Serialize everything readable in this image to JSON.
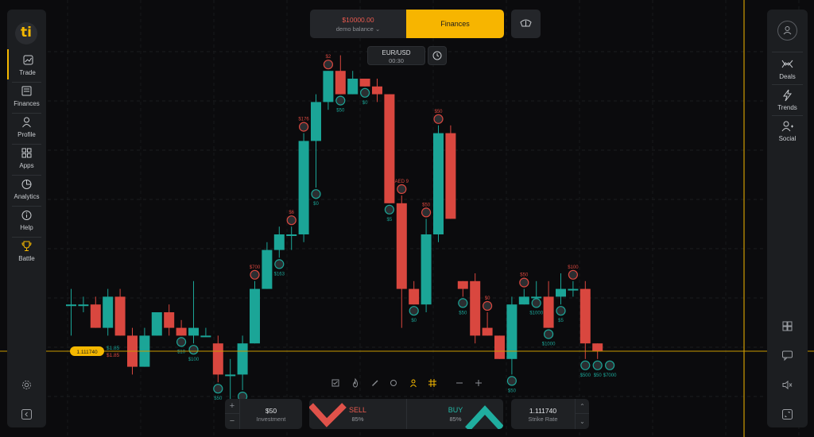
{
  "app": {
    "logo_text": "ti"
  },
  "sidebar_left": {
    "items": [
      {
        "label": "Trade",
        "icon": "chart-icon"
      },
      {
        "label": "Finances",
        "icon": "wallet-icon"
      },
      {
        "label": "Profile",
        "icon": "user-icon"
      },
      {
        "label": "Apps",
        "icon": "apps-icon"
      },
      {
        "label": "Analytics",
        "icon": "pie-icon"
      },
      {
        "label": "Help",
        "icon": "info-icon"
      },
      {
        "label": "Battle",
        "icon": "trophy-icon"
      }
    ],
    "bottom_icons": [
      "settings-icon",
      "collapse-icon"
    ]
  },
  "sidebar_right": {
    "items": [
      {
        "label": "Deals",
        "icon": "deals-icon"
      },
      {
        "label": "Trends",
        "icon": "trends-icon"
      },
      {
        "label": "Social",
        "icon": "add-user-icon"
      }
    ],
    "bottom_icons": [
      "layout-icon",
      "chat-icon",
      "sound-off-icon",
      "fullscreen-icon"
    ]
  },
  "header": {
    "balance": "$10000.00",
    "balance_type": "demo balance",
    "finances_label": "Finances"
  },
  "asset": {
    "name": "EUR/USD",
    "timer": "00:30"
  },
  "trade_panel": {
    "investment_value": "$50",
    "investment_label": "Investment",
    "plus": "+",
    "minus": "−",
    "sell_label": "SELL",
    "sell_pct": "85%",
    "buy_label": "BUY",
    "buy_pct": "85%",
    "strike_value": "1.111740",
    "strike_label": "Strike Rate"
  },
  "colors": {
    "up": "#1ba597",
    "down": "#d9473f",
    "accent": "#f5b800",
    "background": "#0b0b0d"
  },
  "chart_data": {
    "type": "candlestick",
    "current_price": "1.111740",
    "current_price_labels": [
      "$1.85",
      "$1.85"
    ],
    "candles": [
      {
        "t": 0,
        "o": 1.1118,
        "h": 1.11182,
        "l": 1.11176,
        "c": 1.1118
      },
      {
        "t": 1,
        "o": 1.1118,
        "h": 1.11181,
        "l": 1.11179,
        "c": 1.1118
      },
      {
        "t": 2,
        "o": 1.1118,
        "h": 1.11181,
        "l": 1.11177,
        "c": 1.11177
      },
      {
        "t": 3,
        "o": 1.11177,
        "h": 1.11182,
        "l": 1.11176,
        "c": 1.11181
      },
      {
        "t": 4,
        "o": 1.11181,
        "h": 1.11182,
        "l": 1.11176,
        "c": 1.11176
      },
      {
        "t": 5,
        "o": 1.11176,
        "h": 1.11177,
        "l": 1.11171,
        "c": 1.11172
      },
      {
        "t": 6,
        "o": 1.11172,
        "h": 1.11177,
        "l": 1.11172,
        "c": 1.11176
      },
      {
        "t": 7,
        "o": 1.11176,
        "h": 1.11179,
        "l": 1.11176,
        "c": 1.11179
      },
      {
        "t": 8,
        "o": 1.11179,
        "h": 1.1118,
        "l": 1.11176,
        "c": 1.11177
      },
      {
        "t": 9,
        "o": 1.11177,
        "h": 1.11178,
        "l": 1.11176,
        "c": 1.11176
      },
      {
        "t": 10,
        "o": 1.11176,
        "h": 1.11183,
        "l": 1.11175,
        "c": 1.11177
      },
      {
        "t": 11,
        "o": 1.11176,
        "h": 1.11177,
        "l": 1.11176,
        "c": 1.11176
      },
      {
        "t": 12,
        "o": 1.11175,
        "h": 1.11176,
        "l": 1.1117,
        "c": 1.11171
      },
      {
        "t": 13,
        "o": 1.11171,
        "h": 1.11173,
        "l": 1.11166,
        "c": 1.11171
      },
      {
        "t": 14,
        "o": 1.11171,
        "h": 1.11176,
        "l": 1.11169,
        "c": 1.11175
      },
      {
        "t": 15,
        "o": 1.11175,
        "h": 1.11183,
        "l": 1.11175,
        "c": 1.11182
      },
      {
        "t": 16,
        "o": 1.11182,
        "h": 1.11188,
        "l": 1.11182,
        "c": 1.11187
      },
      {
        "t": 17,
        "o": 1.11187,
        "h": 1.1119,
        "l": 1.11186,
        "c": 1.11189
      },
      {
        "t": 18,
        "o": 1.11189,
        "h": 1.1119,
        "l": 1.11187,
        "c": 1.11189
      },
      {
        "t": 19,
        "o": 1.11189,
        "h": 1.11202,
        "l": 1.11188,
        "c": 1.11201
      },
      {
        "t": 20,
        "o": 1.11201,
        "h": 1.11207,
        "l": 1.11195,
        "c": 1.11206
      },
      {
        "t": 21,
        "o": 1.11206,
        "h": 1.1121,
        "l": 1.11205,
        "c": 1.1121
      },
      {
        "t": 22,
        "o": 1.1121,
        "h": 1.11212,
        "l": 1.11207,
        "c": 1.11207
      },
      {
        "t": 23,
        "o": 1.11207,
        "h": 1.1121,
        "l": 1.11207,
        "c": 1.11209
      },
      {
        "t": 24,
        "o": 1.11209,
        "h": 1.11209,
        "l": 1.11208,
        "c": 1.11208
      },
      {
        "t": 25,
        "o": 1.11208,
        "h": 1.11209,
        "l": 1.11206,
        "c": 1.11207
      },
      {
        "t": 26,
        "o": 1.11207,
        "h": 1.11207,
        "l": 1.11193,
        "c": 1.11193
      },
      {
        "t": 27,
        "o": 1.11193,
        "h": 1.11194,
        "l": 1.11177,
        "c": 1.11182
      },
      {
        "t": 28,
        "o": 1.11182,
        "h": 1.11183,
        "l": 1.1118,
        "c": 1.1118
      },
      {
        "t": 29,
        "o": 1.1118,
        "h": 1.11191,
        "l": 1.11179,
        "c": 1.11189
      },
      {
        "t": 30,
        "o": 1.11189,
        "h": 1.11203,
        "l": 1.11188,
        "c": 1.11202
      },
      {
        "t": 31,
        "o": 1.11202,
        "h": 1.11203,
        "l": 1.11191,
        "c": 1.11191
      },
      {
        "t": 32,
        "o": 1.11183,
        "h": 1.11183,
        "l": 1.11181,
        "c": 1.11182
      },
      {
        "t": 33,
        "o": 1.11183,
        "h": 1.11184,
        "l": 1.11175,
        "c": 1.11176
      },
      {
        "t": 34,
        "o": 1.11177,
        "h": 1.11179,
        "l": 1.11176,
        "c": 1.11176
      },
      {
        "t": 35,
        "o": 1.11176,
        "h": 1.11176,
        "l": 1.11173,
        "c": 1.11173
      },
      {
        "t": 36,
        "o": 1.11173,
        "h": 1.11181,
        "l": 1.11171,
        "c": 1.1118
      },
      {
        "t": 37,
        "o": 1.1118,
        "h": 1.11182,
        "l": 1.1118,
        "c": 1.11181
      },
      {
        "t": 38,
        "o": 1.11181,
        "h": 1.11183,
        "l": 1.11181,
        "c": 1.11181
      },
      {
        "t": 39,
        "o": 1.11181,
        "h": 1.11183,
        "l": 1.11177,
        "c": 1.11177
      },
      {
        "t": 40,
        "o": 1.11181,
        "h": 1.11184,
        "l": 1.1118,
        "c": 1.11182
      },
      {
        "t": 41,
        "o": 1.11182,
        "h": 1.11183,
        "l": 1.11181,
        "c": 1.11182
      },
      {
        "t": 42,
        "o": 1.11182,
        "h": 1.11183,
        "l": 1.11173,
        "c": 1.11175
      },
      {
        "t": 43,
        "o": 1.11175,
        "h": 1.11175,
        "l": 1.11173,
        "c": 1.11174
      }
    ],
    "trade_markers": [
      {
        "t": 9,
        "label": "$10",
        "dir": "up"
      },
      {
        "t": 10,
        "label": "$100",
        "dir": "up"
      },
      {
        "t": 12,
        "label": "$50",
        "dir": "up"
      },
      {
        "t": 14,
        "label": "",
        "dir": "up"
      },
      {
        "t": 15,
        "label": "$700",
        "dir": "down"
      },
      {
        "t": 17,
        "label": "$163",
        "dir": "up"
      },
      {
        "t": 18,
        "label": "$6",
        "dir": "down"
      },
      {
        "t": 19,
        "label": "$176",
        "dir": "down"
      },
      {
        "t": 20,
        "label": "$0",
        "dir": "up"
      },
      {
        "t": 21,
        "label": "$2",
        "dir": "down"
      },
      {
        "t": 22,
        "label": "$50",
        "dir": "up"
      },
      {
        "t": 24,
        "label": "$0",
        "dir": "up"
      },
      {
        "t": 26,
        "label": "$5",
        "dir": "up"
      },
      {
        "t": 27,
        "label": "AED 9",
        "dir": "down"
      },
      {
        "t": 28,
        "label": "$0",
        "dir": "up"
      },
      {
        "t": 29,
        "label": "$50",
        "dir": "down"
      },
      {
        "t": 30,
        "label": "$50",
        "dir": "down"
      },
      {
        "t": 32,
        "label": "$50",
        "dir": "up"
      },
      {
        "t": 34,
        "label": "$0",
        "dir": "down"
      },
      {
        "t": 36,
        "label": "$50",
        "dir": "up"
      },
      {
        "t": 37,
        "label": "$50",
        "dir": "down"
      },
      {
        "t": 38,
        "label": "$1000",
        "dir": "up"
      },
      {
        "t": 39,
        "label": "$1000",
        "dir": "up"
      },
      {
        "t": 40,
        "label": "$5",
        "dir": "up"
      },
      {
        "t": 41,
        "label": "$100",
        "dir": "down"
      },
      {
        "t": 42,
        "label": "$500",
        "dir": "up"
      },
      {
        "t": 43,
        "label": "$50",
        "dir": "up"
      },
      {
        "t": 44,
        "label": "$7000",
        "dir": "up"
      }
    ],
    "ylim": [
      1.11164,
      1.11214
    ]
  }
}
